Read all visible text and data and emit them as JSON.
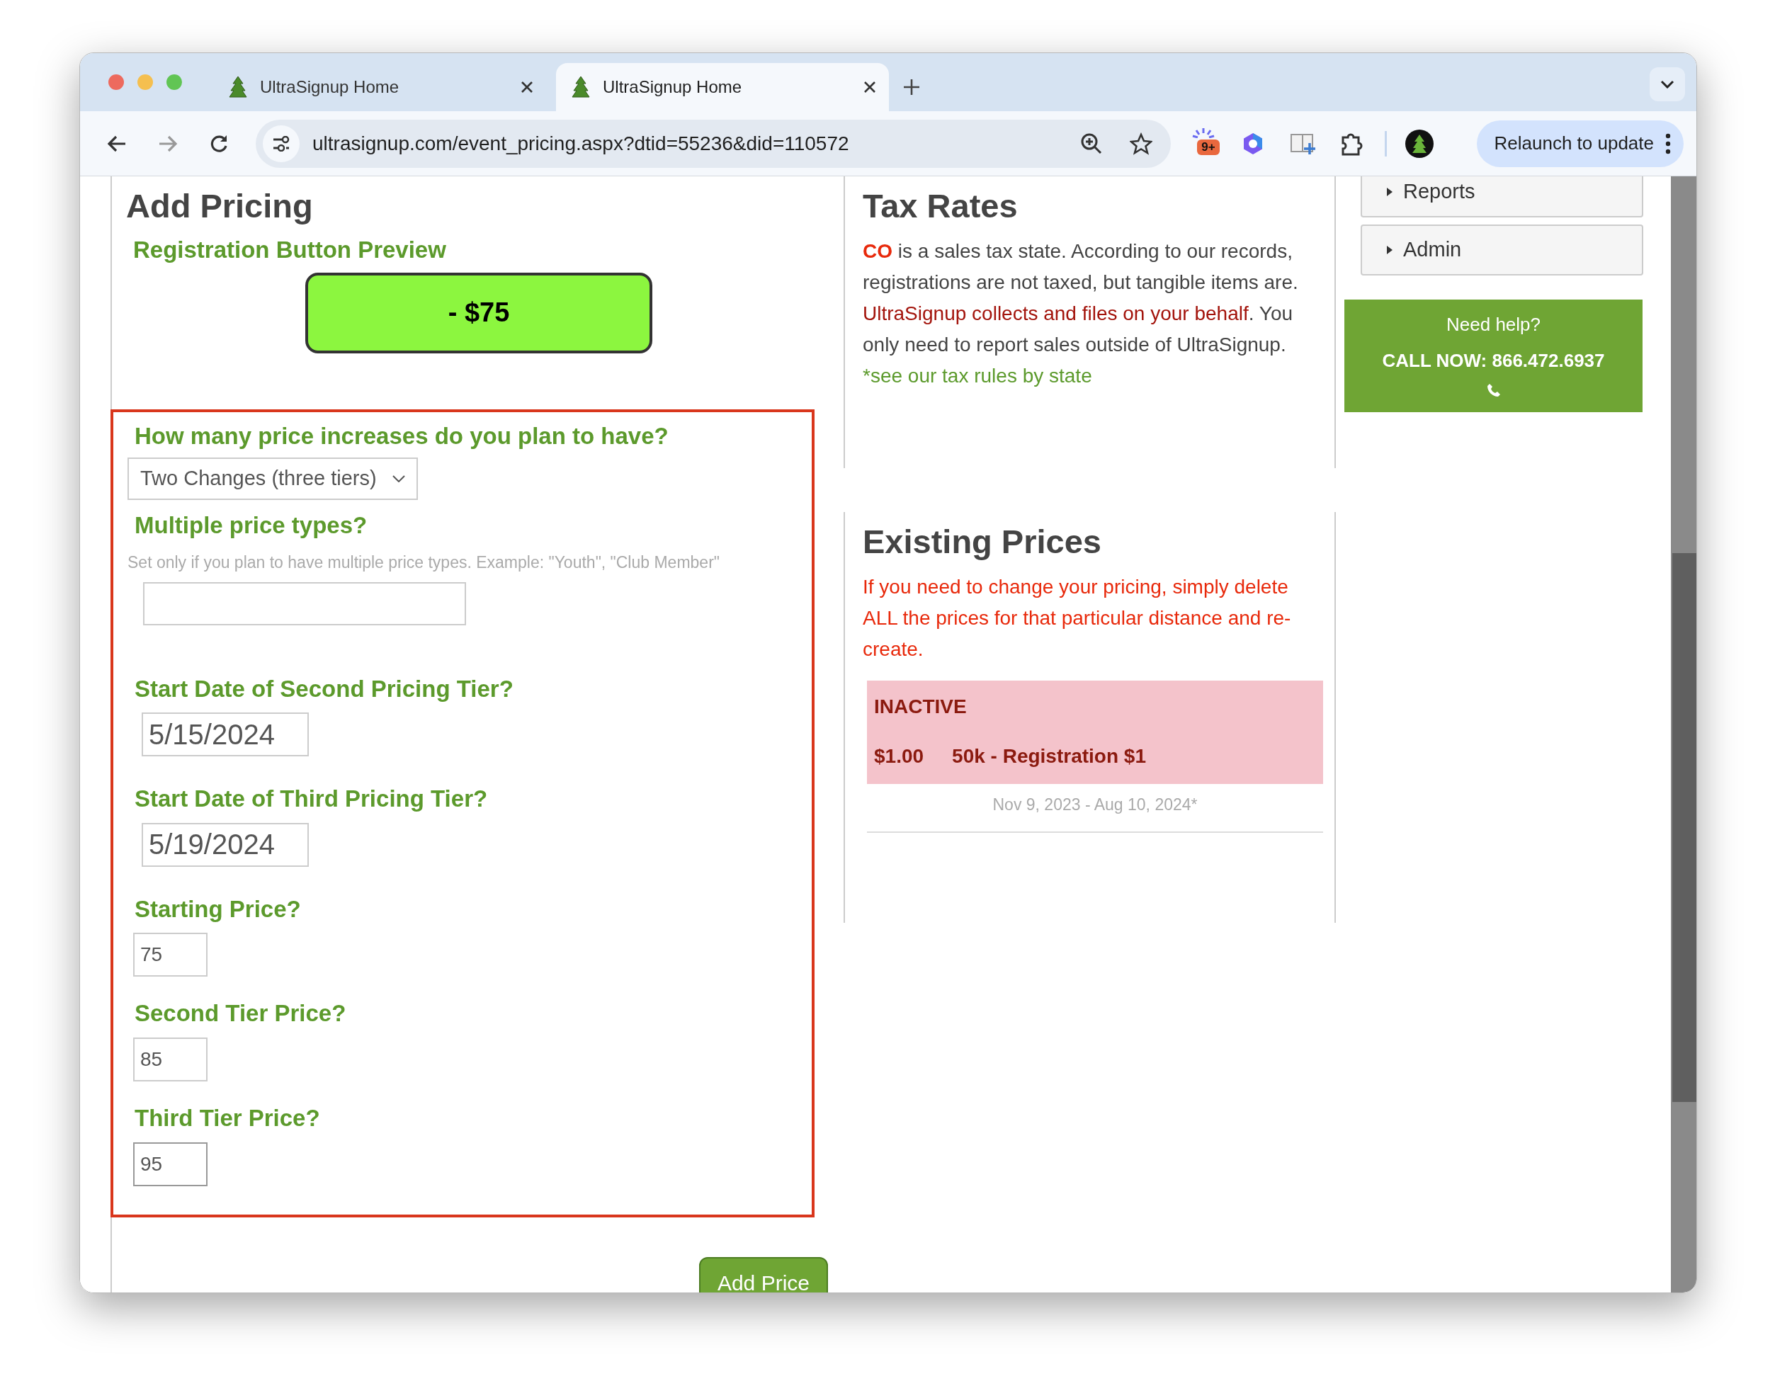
{
  "browser": {
    "tabs": [
      {
        "title": "UltraSignup Home",
        "selected": false
      },
      {
        "title": "UltraSignup Home",
        "selected": true
      }
    ],
    "address": "ultrasignup.com/event_pricing.aspx?dtid=55236&did=110572",
    "extension_badge": "9+",
    "relaunch_button": "Relaunch to update"
  },
  "add_pricing": {
    "title": "Add Pricing",
    "preview_label": "Registration Button Preview",
    "preview_button": "- $75",
    "questions": [
      {
        "kind": "select",
        "label": "How many price increases do you plan to have?",
        "value": "Two Changes (three tiers)"
      },
      {
        "kind": "text",
        "label": "Multiple price types?",
        "hint": "Set only if you plan to have multiple price types. Example: \"Youth\", \"Club Member\""
      },
      {
        "kind": "date",
        "label": "Start Date of Second Pricing Tier?",
        "value": "5/15/2024"
      },
      {
        "kind": "date",
        "label": "Start Date of Third Pricing Tier?",
        "value": "5/19/2024"
      },
      {
        "kind": "price",
        "label": "Starting Price?",
        "value": "75",
        "focused": false
      },
      {
        "kind": "price",
        "label": "Second Tier Price?",
        "value": "85",
        "focused": false
      },
      {
        "kind": "price",
        "label": "Third Tier Price?",
        "value": "95",
        "focused": true
      }
    ],
    "add_button": "Add Price"
  },
  "tax_rates": {
    "title": "Tax Rates",
    "text": [
      {
        "kind": "state",
        "text": "CO"
      },
      {
        "kind": "plain",
        "text": " is a sales tax state. According to our records, registrations are not taxed, but tangible items are. "
      },
      {
        "kind": "highlight",
        "text": "UltraSignup collects and files on your behalf"
      },
      {
        "kind": "plain",
        "text": ". You only need to report sales outside of UltraSignup."
      }
    ],
    "link": "*see our tax rules by state"
  },
  "existing_prices": {
    "title": "Existing Prices",
    "note": "If you need to change your pricing, simply delete ALL the prices for that particular distance and re-create.",
    "prices": [
      {
        "active": false,
        "status": "INACTIVE",
        "amount": "$1.00",
        "name": "50k - Registration $1",
        "dates": "Nov 9, 2023 - Aug 10, 2024*"
      }
    ]
  },
  "sidebar": {
    "menu": [
      {
        "label": "Reports",
        "expanded": false
      },
      {
        "label": "Admin",
        "expanded": false
      }
    ],
    "help": {
      "title": "Need help?",
      "phone": "CALL NOW: 866.472.6937"
    }
  }
}
